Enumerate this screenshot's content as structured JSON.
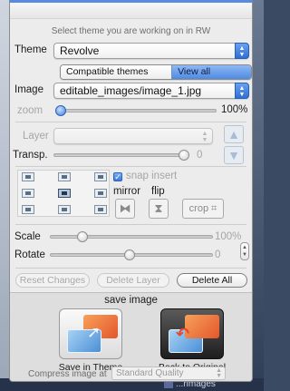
{
  "hint": "Select theme you are working on in RW",
  "theme": {
    "label": "Theme",
    "value": "Revolve"
  },
  "filter": {
    "compatible": "Compatible themes only",
    "all": "View all Themes",
    "selected": "View all Themes"
  },
  "image": {
    "label": "Image",
    "value": "editable_images/image_1.jpg"
  },
  "zoom": {
    "label": "zoom",
    "value": "100%",
    "fraction": 0.0
  },
  "layer": {
    "label": "Layer",
    "value": ""
  },
  "transp": {
    "label": "Transp.",
    "value": "0",
    "fraction": 1.0
  },
  "snap": {
    "label": "snap insert",
    "checked": true
  },
  "transform": {
    "mirror": "mirror",
    "flip": "flip",
    "crop": "crop"
  },
  "scale": {
    "label": "Scale",
    "value": "100%",
    "fraction": 0.21
  },
  "rotate": {
    "label": "Rotate",
    "value": "0",
    "fraction": 0.5
  },
  "buttons": {
    "reset": "Reset Changes",
    "delete_layer": "Delete Layer",
    "delete_all": "Delete All"
  },
  "save": {
    "title": "save image",
    "save_in_theme": "Save in Theme",
    "back_to_original": "Back to Original",
    "compress_label": "Compress image at",
    "compress_value": "Standard Quality"
  },
  "background_fragment": "...rimages",
  "colors": {
    "accent": "#3f7fe0",
    "panel": "#ececec",
    "tile_orange": "#e4562b",
    "tile_blue": "#4a8fd6"
  }
}
